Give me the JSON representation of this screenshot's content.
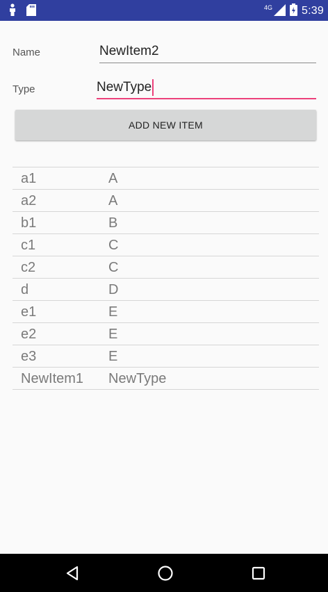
{
  "status_bar": {
    "network": "4G",
    "time": "5:39",
    "icons": [
      "person-icon",
      "sd-card-icon",
      "signal-icon",
      "battery-icon"
    ]
  },
  "form": {
    "name_label": "Name",
    "name_value": "NewItem2",
    "type_label": "Type",
    "type_value": "NewType"
  },
  "add_button": {
    "label": "ADD NEW ITEM"
  },
  "items": [
    {
      "name": "a1",
      "type": "A"
    },
    {
      "name": "a2",
      "type": "A"
    },
    {
      "name": "b1",
      "type": "B"
    },
    {
      "name": "c1",
      "type": "C"
    },
    {
      "name": "c2",
      "type": "C"
    },
    {
      "name": "d",
      "type": "D"
    },
    {
      "name": "e1",
      "type": "E"
    },
    {
      "name": "e2",
      "type": "E"
    },
    {
      "name": "e3",
      "type": "E"
    },
    {
      "name": "NewItem1",
      "type": "NewType"
    }
  ],
  "nav_bar": {
    "icons": [
      "back-icon",
      "home-icon",
      "recents-icon"
    ]
  },
  "colors": {
    "status_bar": "#303f9f",
    "accent": "#ec407a",
    "button": "#d6d7d7"
  }
}
